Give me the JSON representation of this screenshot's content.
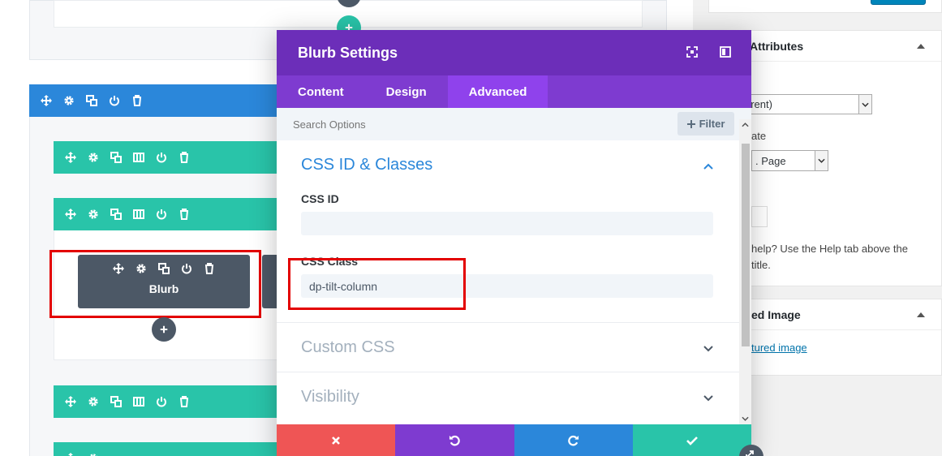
{
  "modal": {
    "title": "Blurb Settings",
    "tabs": [
      {
        "label": "Content",
        "active": false
      },
      {
        "label": "Design",
        "active": false
      },
      {
        "label": "Advanced",
        "active": true
      }
    ],
    "search_placeholder": "Search Options",
    "filter_label": "Filter",
    "sections": {
      "css_id_classes": {
        "title": "CSS ID & Classes",
        "css_id_label": "CSS ID",
        "css_id_value": "",
        "css_class_label": "CSS Class",
        "css_class_value": "dp-tilt-column"
      },
      "custom_css": {
        "title": "Custom CSS"
      },
      "visibility": {
        "title": "Visibility"
      }
    }
  },
  "builder": {
    "module_label": "Blurb"
  },
  "sidebar": {
    "page_attributes_title": "Attributes",
    "parent_select_value": "arent)",
    "template_label": "ate",
    "template_select_value": ". Page",
    "help_text_line1": "help? Use the Help tab above the",
    "help_text_line2": "title.",
    "featured_image_title": "ed Image",
    "featured_image_link": "tured image"
  },
  "colors": {
    "purple_header": "#6c2eb9",
    "purple_tabs": "#7e3bd0",
    "purple_active": "#8f42ec",
    "blue": "#2b87da",
    "teal": "#29c4a9",
    "red": "#ef5555",
    "highlight": "#e30000"
  }
}
